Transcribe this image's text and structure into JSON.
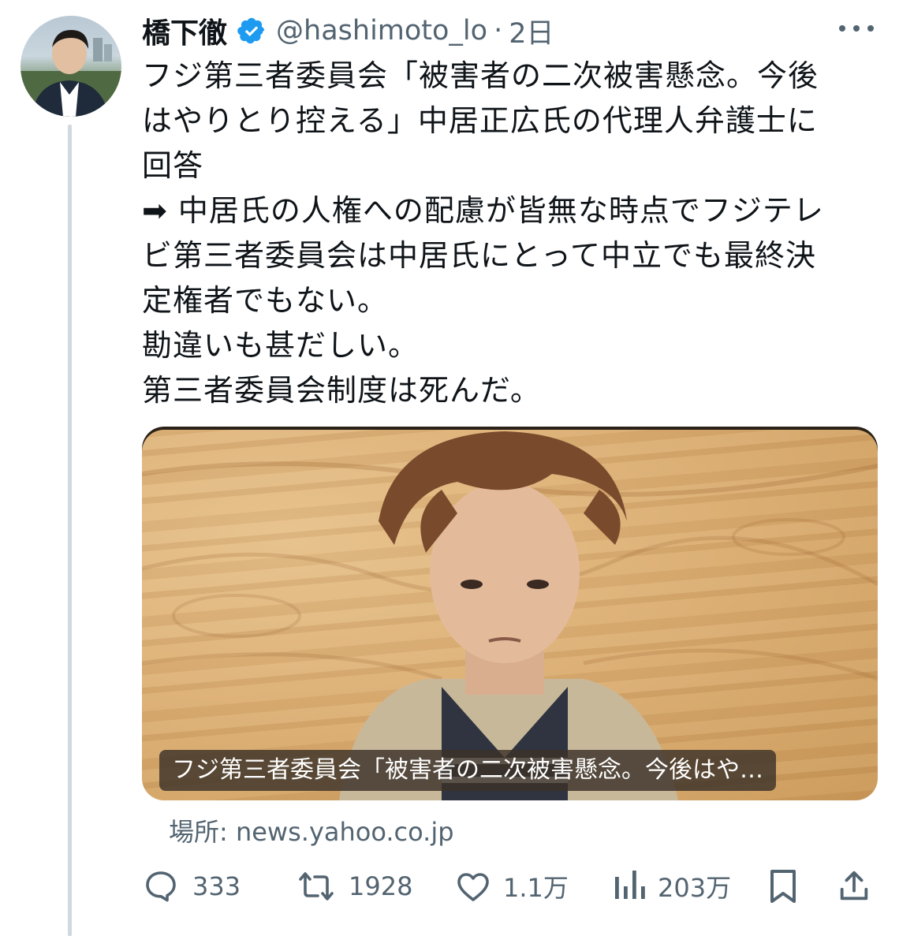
{
  "author": {
    "display_name": "橋下徹",
    "handle": "@hashimoto_lo",
    "separator": "·",
    "time": "2日"
  },
  "tweet": {
    "lines": [
      "フジ第三者委員会「被害者の二次被害懸念。今後",
      "はやりとり控える」中居正広氏の代理人弁護士に",
      "回答",
      "➡ 中居氏の人権への配慮が皆無な時点でフジテレ",
      "ビ第三者委員会は中居氏にとって中立でも最終決",
      "定権者でもない。",
      "勘違いも甚だしい。",
      "第三者委員会制度は死んだ。"
    ]
  },
  "card": {
    "caption": "フジ第三者委員会「被害者の二次被害懸念。今後はや…",
    "source": "場所: news.yahoo.co.jp"
  },
  "actions": {
    "replies": "333",
    "retweets": "1928",
    "likes": "1.1万",
    "views": "203万"
  },
  "icons": {
    "verified": "verified-badge-icon",
    "more": "more-icon",
    "reply": "reply-icon",
    "retweet": "retweet-icon",
    "like": "heart-icon",
    "views": "views-chart-icon",
    "bookmark": "bookmark-icon",
    "share": "share-icon"
  },
  "colors": {
    "verified": "#1d9bf0",
    "text_primary": "#0f1419",
    "text_secondary": "#536471",
    "thread_line": "#cfd9de"
  }
}
